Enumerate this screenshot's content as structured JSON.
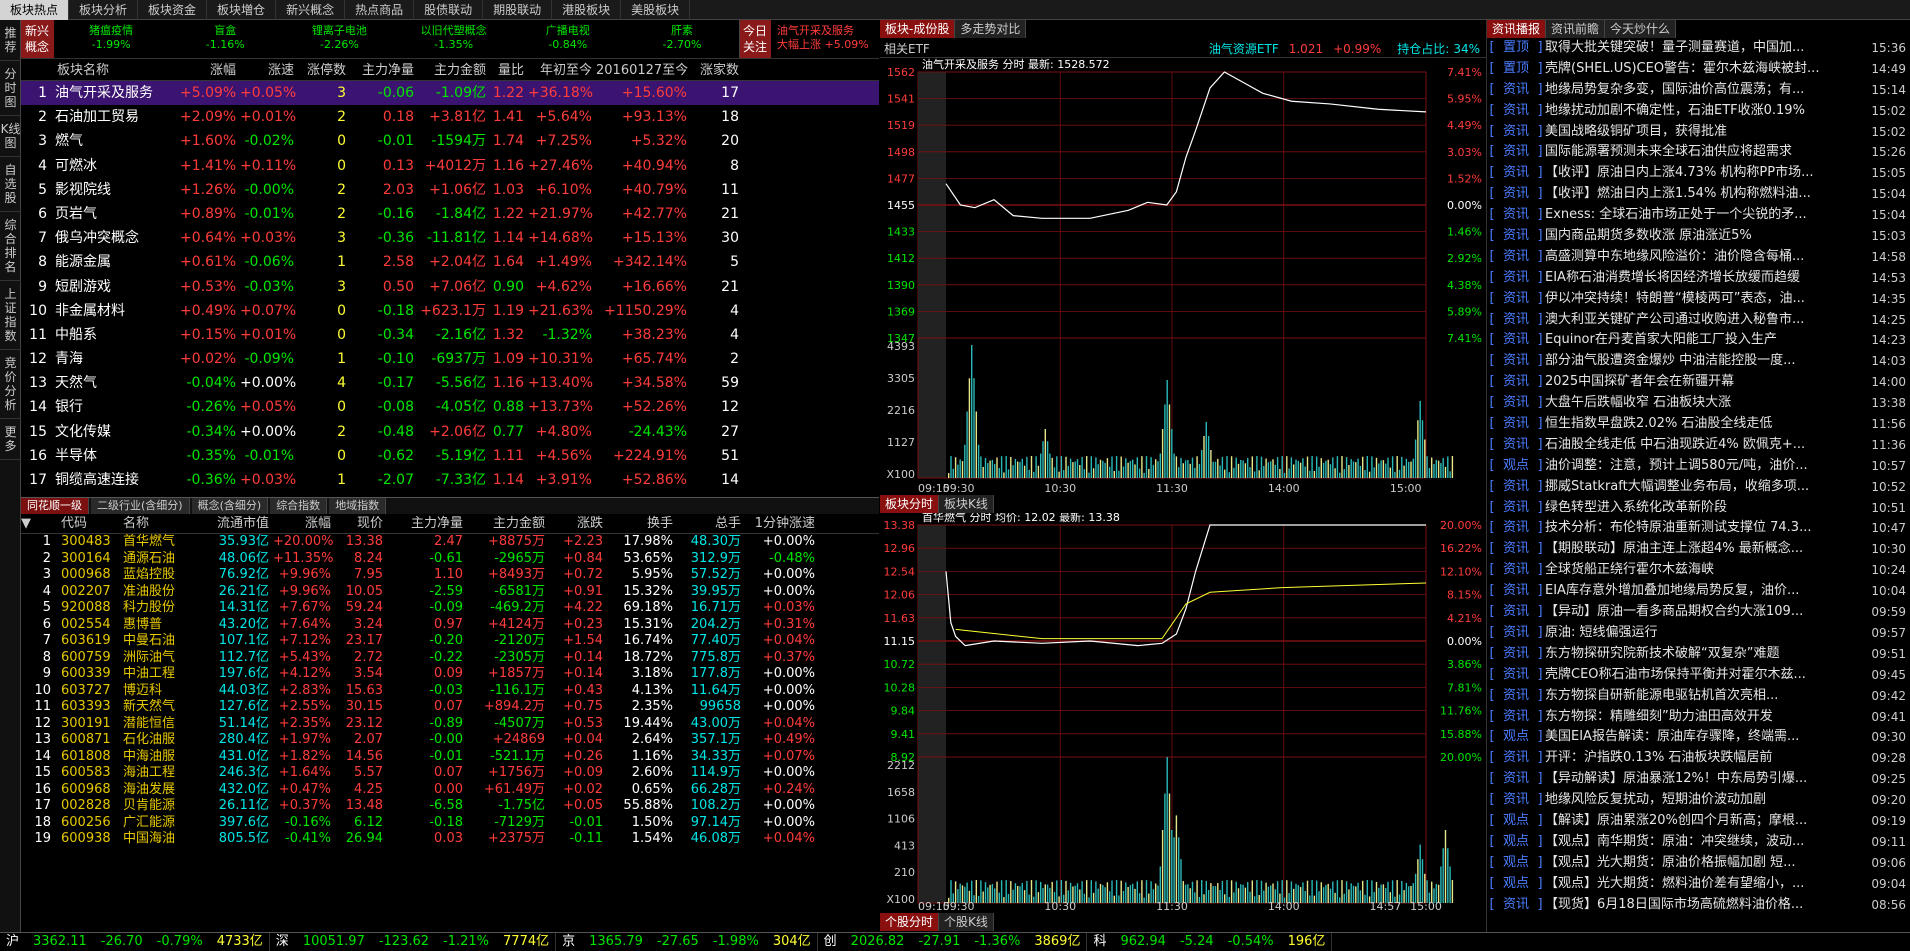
{
  "top_tabs": [
    "板块热点",
    "板块分析",
    "板块资金",
    "板块増仓",
    "新兴概念",
    "热点商品",
    "股债联动",
    "期股联动",
    "港股板块",
    "美股板块"
  ],
  "vertical_tabs": [
    "推荐",
    "分时图",
    "K线图",
    "自选股",
    "综合排名",
    "上证指数",
    "竞价分析",
    "更多"
  ],
  "concept_bar": {
    "label": "新兴概念",
    "items": [
      {
        "name": "猪瘟疫情",
        "pct": "-1.99%"
      },
      {
        "name": "盲盒",
        "pct": "-1.16%"
      },
      {
        "name": "锂离子电池",
        "pct": "-2.26%"
      },
      {
        "name": "以旧代塑概念",
        "pct": "-1.35%"
      },
      {
        "name": "广播电视",
        "pct": "-0.84%"
      },
      {
        "name": "肝素",
        "pct": "-2.70%"
      }
    ],
    "btn": "今日关注",
    "hl_name": "油气开采及服务",
    "hl_sub": "大幅上涨 +5.09%"
  },
  "sector_headers": [
    "板块名称",
    "涨幅",
    "涨速",
    "涨停数",
    "主力净量",
    "主力金额",
    "量比",
    "年初至今",
    "20160127至今",
    "涨家数"
  ],
  "sectors": [
    [
      "1",
      "油气开采及服务",
      "+5.09%",
      "+0.05%",
      "3",
      "-0.06",
      "-1.09亿",
      "1.22",
      "+36.18%",
      "+15.60%",
      "17"
    ],
    [
      "2",
      "石油加工贸易",
      "+2.09%",
      "+0.01%",
      "2",
      "0.18",
      "+3.81亿",
      "1.41",
      "+5.64%",
      "+93.13%",
      "18"
    ],
    [
      "3",
      "燃气",
      "+1.60%",
      "-0.02%",
      "0",
      "-0.01",
      "-1594万",
      "1.74",
      "+7.25%",
      "+5.32%",
      "20"
    ],
    [
      "4",
      "可燃冰",
      "+1.41%",
      "+0.11%",
      "0",
      "0.13",
      "+4012万",
      "1.16",
      "+27.46%",
      "+40.94%",
      "8"
    ],
    [
      "5",
      "影视院线",
      "+1.26%",
      "-0.00%",
      "2",
      "2.03",
      "+1.06亿",
      "1.03",
      "+6.10%",
      "+40.79%",
      "11"
    ],
    [
      "6",
      "页岩气",
      "+0.89%",
      "-0.01%",
      "2",
      "-0.16",
      "-1.84亿",
      "1.22",
      "+21.97%",
      "+42.77%",
      "21"
    ],
    [
      "7",
      "俄乌冲突概念",
      "+0.64%",
      "+0.03%",
      "3",
      "-0.36",
      "-11.81亿",
      "1.14",
      "+14.68%",
      "+15.13%",
      "30"
    ],
    [
      "8",
      "能源金属",
      "+0.61%",
      "-0.06%",
      "1",
      "2.58",
      "+2.04亿",
      "1.64",
      "+1.49%",
      "+342.14%",
      "5"
    ],
    [
      "9",
      "短剧游戏",
      "+0.53%",
      "-0.03%",
      "3",
      "0.50",
      "+7.06亿",
      "0.90",
      "+4.62%",
      "+16.66%",
      "21"
    ],
    [
      "10",
      "非金属材料",
      "+0.49%",
      "+0.07%",
      "0",
      "-0.18",
      "+623.1万",
      "1.19",
      "+21.63%",
      "+1150.29%",
      "4"
    ],
    [
      "11",
      "中船系",
      "+0.15%",
      "+0.01%",
      "0",
      "-0.34",
      "-2.16亿",
      "1.32",
      "-1.32%",
      "+38.23%",
      "4"
    ],
    [
      "12",
      "青海",
      "+0.02%",
      "-0.09%",
      "1",
      "-0.10",
      "-6937万",
      "1.09",
      "+10.31%",
      "+65.74%",
      "2"
    ],
    [
      "13",
      "天然气",
      "-0.04%",
      "+0.00%",
      "4",
      "-0.17",
      "-5.56亿",
      "1.16",
      "+13.40%",
      "+34.58%",
      "59"
    ],
    [
      "14",
      "银行",
      "-0.26%",
      "+0.05%",
      "0",
      "-0.08",
      "-4.05亿",
      "0.88",
      "+13.73%",
      "+52.26%",
      "12"
    ],
    [
      "15",
      "文化传媒",
      "-0.34%",
      "+0.00%",
      "2",
      "-0.48",
      "+2.06亿",
      "0.77",
      "+4.80%",
      "-24.43%",
      "27"
    ],
    [
      "16",
      "半导体",
      "-0.35%",
      "-0.01%",
      "0",
      "-0.62",
      "-5.19亿",
      "1.11",
      "+4.56%",
      "+224.91%",
      "51"
    ],
    [
      "17",
      "铜缆高速连接",
      "-0.36%",
      "+0.03%",
      "1",
      "-2.07",
      "-7.33亿",
      "1.14",
      "+3.91%",
      "+52.86%",
      "14"
    ]
  ],
  "sector_tabs": [
    "同花顺一级",
    "二级行业(含细分)",
    "概念(含细分)",
    "综合指数",
    "地域指数"
  ],
  "stock_headers": [
    "代码",
    "名称",
    "流通市值",
    "涨幅",
    "现价",
    "主力净量",
    "主力金额",
    "涨跌",
    "换手",
    "总手",
    "1分钟涨速"
  ],
  "stocks": [
    [
      "1",
      "300483",
      "首华燃气",
      "35.93亿",
      "+20.00%",
      "13.38",
      "2.47",
      "+8875万",
      "+2.23",
      "17.98%",
      "48.30万",
      "+0.00%"
    ],
    [
      "2",
      "300164",
      "通源石油",
      "48.06亿",
      "+11.35%",
      "8.24",
      "-0.61",
      "-2965万",
      "+0.84",
      "53.65%",
      "312.9万",
      "-0.48%"
    ],
    [
      "3",
      "000968",
      "蓝焰控股",
      "76.92亿",
      "+9.96%",
      "7.95",
      "1.10",
      "+8493万",
      "+0.72",
      "5.95%",
      "57.52万",
      "+0.00%"
    ],
    [
      "4",
      "002207",
      "准油股份",
      "26.21亿",
      "+9.96%",
      "10.05",
      "-2.59",
      "-6581万",
      "+0.91",
      "15.32%",
      "39.95万",
      "+0.00%"
    ],
    [
      "5",
      "920088",
      "科力股份",
      "14.31亿",
      "+7.67%",
      "59.24",
      "-0.09",
      "-469.2万",
      "+4.22",
      "69.18%",
      "16.71万",
      "+0.03%"
    ],
    [
      "6",
      "002554",
      "惠博普",
      "43.20亿",
      "+7.64%",
      "3.24",
      "0.97",
      "+4124万",
      "+0.23",
      "15.31%",
      "204.2万",
      "+0.31%"
    ],
    [
      "7",
      "603619",
      "中曼石油",
      "107.1亿",
      "+7.12%",
      "23.17",
      "-0.20",
      "-2120万",
      "+1.54",
      "16.74%",
      "77.40万",
      "+0.04%"
    ],
    [
      "8",
      "600759",
      "洲际油气",
      "112.7亿",
      "+5.43%",
      "2.72",
      "-0.22",
      "-2305万",
      "+0.14",
      "18.72%",
      "775.8万",
      "+0.37%"
    ],
    [
      "9",
      "600339",
      "中油工程",
      "197.6亿",
      "+4.12%",
      "3.54",
      "0.09",
      "+1857万",
      "+0.14",
      "3.18%",
      "177.8万",
      "+0.00%"
    ],
    [
      "10",
      "603727",
      "博迈科",
      "44.03亿",
      "+2.83%",
      "15.63",
      "-0.03",
      "-116.1万",
      "+0.43",
      "4.13%",
      "11.64万",
      "+0.00%"
    ],
    [
      "11",
      "603393",
      "新天然气",
      "127.6亿",
      "+2.55%",
      "30.15",
      "0.07",
      "+894.2万",
      "+0.75",
      "2.35%",
      "99658",
      "+0.00%"
    ],
    [
      "12",
      "300191",
      "潜能恒信",
      "51.14亿",
      "+2.35%",
      "23.12",
      "-0.89",
      "-4507万",
      "+0.53",
      "19.44%",
      "43.00万",
      "+0.04%"
    ],
    [
      "13",
      "600871",
      "石化油服",
      "280.4亿",
      "+1.97%",
      "2.07",
      "-0.00",
      "+24869",
      "+0.04",
      "2.64%",
      "357.1万",
      "+0.49%"
    ],
    [
      "14",
      "601808",
      "中海油服",
      "431.0亿",
      "+1.82%",
      "14.56",
      "-0.01",
      "-521.1万",
      "+0.26",
      "1.16%",
      "34.33万",
      "+0.07%"
    ],
    [
      "15",
      "600583",
      "海油工程",
      "246.3亿",
      "+1.64%",
      "5.57",
      "0.07",
      "+1756万",
      "+0.09",
      "2.60%",
      "114.9万",
      "+0.00%"
    ],
    [
      "16",
      "600968",
      "海油发展",
      "432.0亿",
      "+0.47%",
      "4.25",
      "0.00",
      "+61.49万",
      "+0.02",
      "0.65%",
      "66.28万",
      "+0.24%"
    ],
    [
      "17",
      "002828",
      "贝肯能源",
      "26.11亿",
      "+0.37%",
      "13.48",
      "-6.58",
      "-1.75亿",
      "+0.05",
      "55.88%",
      "108.2万",
      "+0.00%"
    ],
    [
      "18",
      "600256",
      "广汇能源",
      "397.6亿",
      "-0.16%",
      "6.12",
      "-0.18",
      "-7129万",
      "-0.01",
      "1.50%",
      "97.14万",
      "+0.00%"
    ],
    [
      "19",
      "600938",
      "中国海油",
      "805.5亿",
      "-0.41%",
      "26.94",
      "0.03",
      "+2375万",
      "-0.11",
      "1.54%",
      "46.08万",
      "+0.04%"
    ]
  ],
  "chart1": {
    "tabs": [
      "板块-成份股",
      "多走势对比"
    ],
    "etf_label": "相关ETF",
    "etf_name": "油气资源ETF",
    "etf_price": "1.021",
    "etf_pct": "+0.99%",
    "hold_label": "持仓占比:",
    "hold_pct": "34%",
    "title": "油气开采及服务 分时 最新: 1528.572",
    "prices": [
      "1562",
      "1541",
      "1519",
      "1498",
      "1477",
      "1455",
      "1433",
      "1412",
      "1390",
      "1369",
      "1347"
    ],
    "pcts": [
      "7.41%",
      "5.95%",
      "4.49%",
      "3.03%",
      "1.52%",
      "0.00%",
      "1.46%",
      "2.92%",
      "4.38%",
      "5.89%",
      "7.41%"
    ],
    "vol": [
      "4393",
      "3305",
      "2216",
      "1127",
      "X100"
    ],
    "times": [
      "09:15",
      "09:30",
      "10:30",
      "11:30",
      "14:00",
      "15:00"
    ],
    "bottom_tabs": [
      "板块分时",
      "板块K线"
    ]
  },
  "chart2": {
    "title": "首华燃气 分时 均价: 12.02 最新: 13.38",
    "prices": [
      "13.38",
      "12.96",
      "12.54",
      "12.06",
      "11.63",
      "11.15",
      "10.72",
      "10.28",
      "9.84",
      "9.41",
      "8.92"
    ],
    "pcts": [
      "20.00%",
      "16.22%",
      "12.10%",
      "8.15%",
      "4.21%",
      "0.00%",
      "3.86%",
      "7.81%",
      "11.76%",
      "15.88%",
      "20.00%"
    ],
    "vol": [
      "2212",
      "1658",
      "1106",
      "413",
      "210",
      "X100"
    ],
    "vol_right": "20.00%",
    "times": [
      "09:15",
      "09:30",
      "10:30",
      "11:30",
      "14:00",
      "14:57",
      "15:00"
    ],
    "bottom_tabs": [
      "个股分时",
      "个股K线"
    ]
  },
  "news_tabs": [
    "资讯播报",
    "资讯前瞻",
    "今天炒什么"
  ],
  "news": [
    [
      "置顶",
      "取得大批关键突破！量子测量赛道，中国加...",
      "15:36"
    ],
    [
      "置顶",
      "壳牌(SHEL.US)CEO警告：霍尔木兹海峡被封...",
      "14:49"
    ],
    [
      "资讯",
      "地缘局势复杂多变，国际油价高位震荡；有...",
      "15:14"
    ],
    [
      "资讯",
      "地缘扰动加剧不确定性，石油ETF收涨0.19%",
      "15:02"
    ],
    [
      "资讯",
      "美国战略级铜矿项目，获得批准",
      "15:02"
    ],
    [
      "资讯",
      "国际能源署预测未来全球石油供应将超需求",
      "15:26"
    ],
    [
      "资讯",
      "【收评】原油日内上涨4.73% 机构称PP市场...",
      "15:05"
    ],
    [
      "资讯",
      "【收评】燃油日内上涨1.54% 机构称燃料油...",
      "15:04"
    ],
    [
      "资讯",
      "Exness: 全球石油市场正处于一个尖锐的矛...",
      "15:04"
    ],
    [
      "资讯",
      "国内商品期货多数收涨 原油涨近5%",
      "15:03"
    ],
    [
      "资讯",
      "高盛测算中东地缘风险溢价：油价隐含每桶...",
      "14:58"
    ],
    [
      "资讯",
      "EIA称石油消费增长将因经济增长放缓而趋缓",
      "14:53"
    ],
    [
      "资讯",
      "伊以冲突持续！特朗普“模棱两可”表态，油...",
      "14:35"
    ],
    [
      "资讯",
      "澳大利亚关键矿产公司通过收购进入秘鲁市...",
      "14:25"
    ],
    [
      "资讯",
      "Equinor在丹麦首家大阳能工厂投入生产",
      "14:23"
    ],
    [
      "资讯",
      "部分油气股遭资金爆炒 中油洁能控股一度...",
      "14:03"
    ],
    [
      "资讯",
      "2025中国探矿者年会在新疆开幕",
      "14:00"
    ],
    [
      "资讯",
      "大盘午后跌幅收窄 石油板块大涨",
      "13:38"
    ],
    [
      "资讯",
      "恒生指数早盘跌2.02% 石油股全线走低",
      "11:56"
    ],
    [
      "资讯",
      "石油股全线走低 中石油现跌近4% 欧佩克+...",
      "11:36"
    ],
    [
      "观点",
      "油价调整：注意，预计上调580元/吨，油价...",
      "10:57"
    ],
    [
      "资讯",
      "挪威Statkraft大幅调整业务布局，收缩多项...",
      "10:52"
    ],
    [
      "资讯",
      "绿色转型进入系统化改革新阶段",
      "10:51"
    ],
    [
      "资讯",
      "技术分析：布伦特原油重新测试支撑位 74.3...",
      "10:47"
    ],
    [
      "资讯",
      "【期股联动】原油主连上涨超4% 最新概念...",
      "10:30"
    ],
    [
      "资讯",
      "全球货船正绕行霍尔木兹海峡",
      "10:24"
    ],
    [
      "资讯",
      "EIA库存意外增加叠加地缘局势反复，油价...",
      "10:04"
    ],
    [
      "资讯",
      "【异动】原油一看多商品期权合约大涨109...",
      "09:59"
    ],
    [
      "资讯",
      "原油: 短线偏强运行",
      "09:57"
    ],
    [
      "资讯",
      "东方物探研究院新技术破解“双复杂”难题",
      "09:51"
    ],
    [
      "资讯",
      "壳牌CEO称石油市场保持平衡并对霍尔木兹...",
      "09:45"
    ],
    [
      "资讯",
      "东方物探自研新能源电驱钻机首次亮相...",
      "09:42"
    ],
    [
      "资讯",
      "东方物探：精雕细刻”助力油田高效开发",
      "09:41"
    ],
    [
      "观点",
      "美国EIA报告解读：原油库存骤降，终端需...",
      "09:30"
    ],
    [
      "资讯",
      "开评：沪指跌0.13% 石油板块跌幅居前",
      "09:28"
    ],
    [
      "资讯",
      "【异动解读】原油暴涨12%！中东局势引爆...",
      "09:25"
    ],
    [
      "资讯",
      "地缘风险反复扰动，短期油价波动加剧",
      "09:20"
    ],
    [
      "观点",
      "【解读】原油累涨20%创四个月新高；摩根...",
      "09:19"
    ],
    [
      "观点",
      "【观点】南华期货：原油：冲突继续，波动...",
      "09:11"
    ],
    [
      "观点",
      "【观点】光大期货：原油价格振幅加剧 短...",
      "09:06"
    ],
    [
      "观点",
      "【观点】光大期货：燃料油价差有望缩小，...",
      "09:04"
    ],
    [
      "资讯",
      "【现货】6月18日国际市场高硫燃料油价格...",
      "08:56"
    ]
  ],
  "status": [
    {
      "name": "沪",
      "v": "3362.11",
      "chg": "-26.70",
      "pct": "-0.79%",
      "amt": "4733亿"
    },
    {
      "name": "深",
      "v": "10051.97",
      "chg": "-123.62",
      "pct": "-1.21%",
      "amt": "7774亿"
    },
    {
      "name": "京",
      "v": "1365.79",
      "chg": "-27.65",
      "pct": "-1.98%",
      "amt": "304亿"
    },
    {
      "name": "创",
      "v": "2026.82",
      "chg": "-27.91",
      "pct": "-1.36%",
      "amt": "3869亿"
    },
    {
      "name": "科",
      "v": "962.94",
      "chg": "-5.24",
      "pct": "-0.54%",
      "amt": "196亿"
    }
  ],
  "colors": {
    "up": "#ff3c3c",
    "down": "#00e600",
    "accent": "#8a1010",
    "select": "#3a1470"
  }
}
